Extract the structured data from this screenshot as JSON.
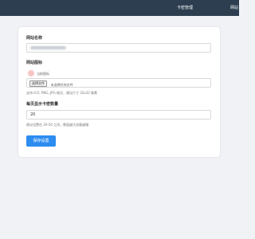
{
  "topbar": {
    "nav_items": [
      "卡密管理",
      "网站"
    ]
  },
  "form": {
    "site_name": {
      "label": "网站名称"
    },
    "site_icon": {
      "label": "网站图标",
      "current_icon_label": "当前图标",
      "file_button_label": "选择文件",
      "file_status": "未选择任何文件",
      "help": "支持 ICO, PNG, JPG 格式，建议尺寸 32x32 像素"
    },
    "cards_per_page": {
      "label": "每页显示卡密数量",
      "value": "20",
      "help": "建议设置在 20-50 之间，数值越大加载越慢"
    },
    "save_button_label": "保存设置"
  },
  "colors": {
    "topbar": "#2c3e50",
    "page_background": "#f0f2f5",
    "primary_button": "#2d8cf0"
  }
}
